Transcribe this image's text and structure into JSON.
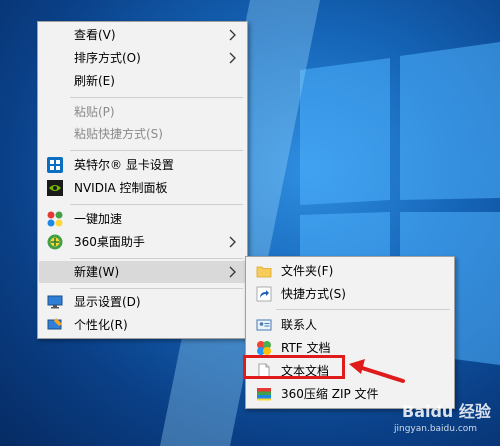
{
  "main_menu": {
    "items": [
      {
        "label": "查看(V)"
      },
      {
        "label": "排序方式(O)"
      },
      {
        "label": "刷新(E)"
      },
      {
        "label": "粘贴(P)"
      },
      {
        "label": "粘贴快捷方式(S)"
      },
      {
        "label": "英特尔® 显卡设置"
      },
      {
        "label": "NVIDIA 控制面板"
      },
      {
        "label": "一键加速"
      },
      {
        "label": "360桌面助手"
      },
      {
        "label": "新建(W)"
      },
      {
        "label": "显示设置(D)"
      },
      {
        "label": "个性化(R)"
      }
    ]
  },
  "sub_menu": {
    "items": [
      {
        "label": "文件夹(F)"
      },
      {
        "label": "快捷方式(S)"
      },
      {
        "label": "联系人"
      },
      {
        "label": "RTF 文档"
      },
      {
        "label": "文本文档"
      },
      {
        "label": "360压缩 ZIP 文件"
      }
    ]
  },
  "watermark": {
    "brand": "Baidu 经验",
    "url": "jingyan.baidu.com"
  },
  "colors": {
    "highlight": "#e01b1b",
    "menu_bg": "#f2f2f2",
    "hover": "#d9d9d9",
    "desktop": "#1565b8"
  }
}
